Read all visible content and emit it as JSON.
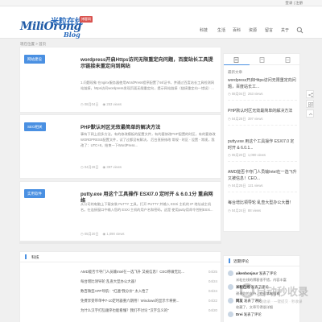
{
  "topbar": {
    "link": "登录 | 注册"
  },
  "header": {
    "logo": {
      "latin": "MiliOrong",
      "cn": "米粒在线",
      "badge": "博客网",
      "blog": "Blog"
    },
    "nav": [
      "科技",
      "生活",
      "百科",
      "资源",
      "留言",
      "关于"
    ]
  },
  "breadcrumb": "现在位置 > 首页",
  "posts": [
    {
      "category": "网站建设",
      "title": "wordpress开启Https访问无限重定向问题，百度站长工具提示链接未重定向到网站",
      "excerpt": "1.问题现象 在nginx服务器使用WordPress程序配置了ssl证书，并通过百度站长工具检测网站链接，https访问wordpress发现页面无限重定向，提示网站链接（链接重定向一错误）...",
      "date": "08月04日",
      "views": "253 views"
    },
    {
      "category": "SEO相关",
      "title": "PHP默认时区无效最简单的解决方法",
      "excerpt": "事有下网上很多方法，有的修改模板的配置文件，有的要修改PHP配置的时区，有的要修改WORDPRESS配置文件，试了过都没有解决。 后台直接修改 常规 - 时区 - 设置 - 常规，我改了：UTC+8，结束一下WordPress...",
      "date": "04月28日",
      "views": "397 views"
    },
    {
      "category": "实用软件",
      "title": "putty.exe 用这个工具操作 ESXI7.0 定时开 & 6.0.1分 重启网络",
      "excerpt": "从公司的电脑上下载安装 PuTTY 工具。打开 PUTTY 并输入 ESXi 主机的 IP 地址或主机名。在连接窗口中输入您的 ESXi 主机的用户名和密码。这是 使用putty用命令控制ESXi...",
      "date": "05月20日",
      "views": "1,090 views"
    }
  ],
  "widget": {
    "title": "科技",
    "items": [
      {
        "text": "AMD能否卡夺门人员输Intel在一选飞升 又被信息！CEO称做无比...",
        "date": "04/25"
      },
      {
        "text": "每台增比领导轮 乱查大型办公大器！",
        "date": "04/24"
      },
      {
        "text": "数百微型APP导航：\"红遍\"我分价\" 太入性了",
        "date": "04/24"
      },
      {
        "text": "免费享受带单中7-10定时器重六期用！Windows的显示卡将要...",
        "date": "04/22"
      },
      {
        "text": "为什么汉字打乱顺序也能看懂？我们不讨论 \"汉字怎义的\"",
        "date": "04/20"
      }
    ]
  },
  "sidebar": {
    "heading": "最新文章",
    "posts": [
      {
        "title": "wordpress开启Https访问无限重定向问题，百度站长工...",
        "date": "08月04日",
        "views": "253 views"
      },
      {
        "title": "PHP默认时区无效最简单的解决方法",
        "date": "04月28日",
        "views": "397 views"
      },
      {
        "title": "putty.exe 用这个工具操作 ESXI7.0 定时开 & 6.0.1...",
        "date": "05月20日",
        "views": "1,090 views"
      },
      {
        "title": "AMD能否卡夺门人员输Intel在一选飞升 又被信息！CEO...",
        "date": "04月25日",
        "views": "121 views"
      },
      {
        "title": "每台增比领导轮 乱查大型办公大器！",
        "date": "04月24日",
        "views": "88 views"
      }
    ],
    "comments_title": "近期评论",
    "comments": [
      {
        "name": "aikenbonjour",
        "action": "发表了评论",
        "text": "米粒在线的博客很不错，内容丰富",
        "date": "11/06"
      },
      {
        "name": "米粒在线",
        "action": "发表了评论",
        "text": "谢谢你的支持，欢迎常来看看",
        "date": "11/06"
      },
      {
        "name": "网友",
        "action": "发表了评论",
        "text": "收藏了，文章写得很详细",
        "date": "10/28"
      },
      {
        "name": "Drei",
        "action": "发表了评论",
        "text": "学习了，感谢分享",
        "date": "10/20"
      }
    ]
  },
  "watermark": {
    "text": "自动秒收录",
    "sub": "网站收录 · 一键提交 · 秒收录"
  },
  "colors": {
    "accent": "#4a90e2",
    "text": "#333333",
    "muted": "#aaaaaa"
  }
}
